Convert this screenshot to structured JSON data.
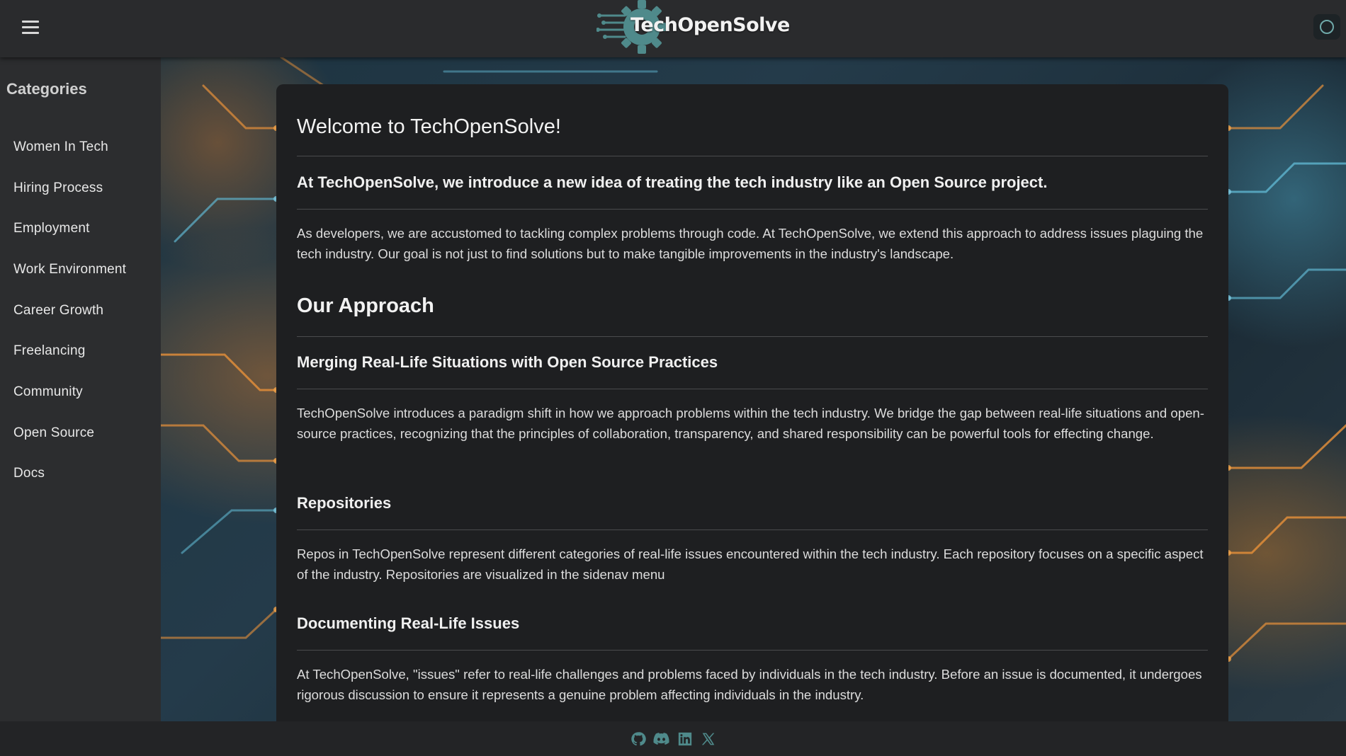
{
  "header": {
    "brand": "TechOpenSolve",
    "menu_icon": "hamburger-menu-icon",
    "theme_icon": "moon-icon"
  },
  "sidebar": {
    "title": "Categories",
    "items": [
      {
        "label": "Women In Tech"
      },
      {
        "label": "Hiring Process"
      },
      {
        "label": "Employment"
      },
      {
        "label": "Work Environment"
      },
      {
        "label": "Career Growth"
      },
      {
        "label": "Freelancing"
      },
      {
        "label": "Community"
      },
      {
        "label": "Open Source"
      },
      {
        "label": "Docs"
      }
    ]
  },
  "main": {
    "title": "Welcome to TechOpenSolve!",
    "lead": "At TechOpenSolve, we introduce a new idea of treating the tech industry like an Open Source project.",
    "intro": "As developers, we are accustomed to tackling complex problems through code. At TechOpenSolve, we extend this approach to address issues plaguing the tech industry. Our goal is not just to find solutions but to make tangible improvements in the industry's landscape.",
    "approach_heading": "Our Approach",
    "merging_heading": "Merging Real-Life Situations with Open Source Practices",
    "merging_text": "TechOpenSolve introduces a paradigm shift in how we approach problems within the tech industry. We bridge the gap between real-life situations and open-source practices, recognizing that the principles of collaboration, transparency, and shared responsibility can be powerful tools for effecting change.",
    "repos_heading": "Repositories",
    "repos_text": "Repos in TechOpenSolve represent different categories of real-life issues encountered within the tech industry. Each repository focuses on a specific aspect of the industry. Repositories are visualized in the sidenav menu",
    "documenting_heading": "Documenting Real-Life Issues",
    "documenting_text": "At TechOpenSolve, \"issues\" refer to real-life challenges and problems faced by individuals in the tech industry. Before an issue is documented, it undergoes rigorous discussion to ensure it represents a genuine problem affecting individuals in the industry."
  },
  "footer": {
    "links": [
      "github-icon",
      "discord-icon",
      "linkedin-icon",
      "x-icon"
    ],
    "icon_color": "#4f8a8b"
  },
  "colors": {
    "accent": "#4f8a8b",
    "topbar": "#2a2b2d",
    "sidebar": "#2c2d2f",
    "card": "#1e1f21"
  }
}
